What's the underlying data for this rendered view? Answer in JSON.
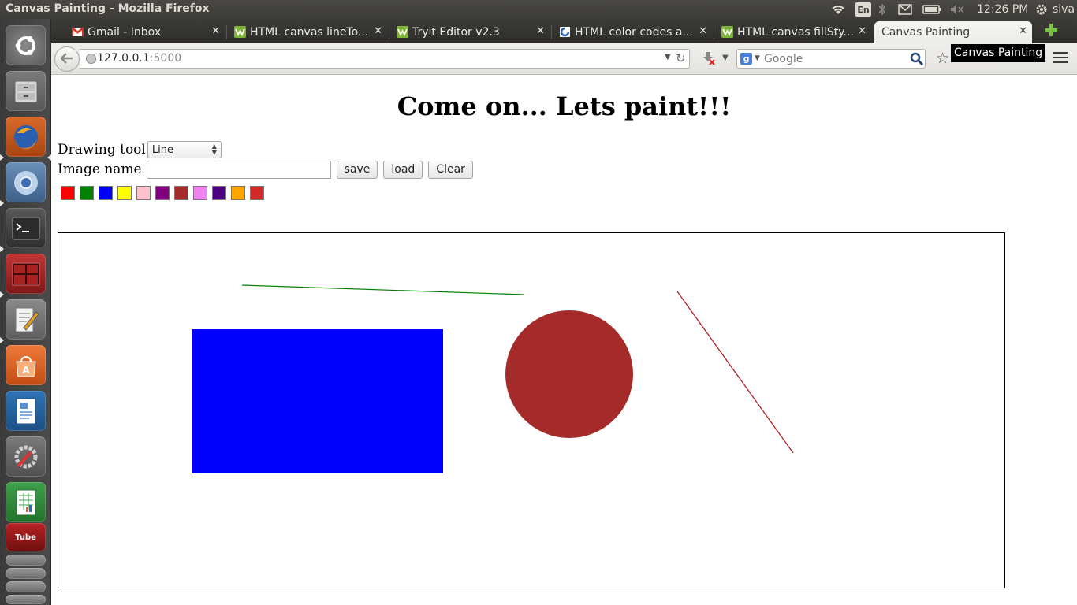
{
  "topbar": {
    "window_title": "Canvas Painting - Mozilla Firefox",
    "lang": "En",
    "clock": "12:26 PM",
    "user": "siva"
  },
  "tabs": [
    {
      "label": "Gmail - Inbox",
      "icon": "gmail-icon",
      "active": false
    },
    {
      "label": "HTML canvas lineTo...",
      "icon": "w3schools-icon",
      "active": false
    },
    {
      "label": "Tryit Editor v2.3",
      "icon": "w3schools-icon",
      "active": false
    },
    {
      "label": "HTML color codes a...",
      "icon": "colorcodes-icon",
      "active": false
    },
    {
      "label": "HTML canvas fillSty...",
      "icon": "w3schools-icon",
      "active": false
    },
    {
      "label": "Canvas Painting",
      "icon": "",
      "active": true
    }
  ],
  "navbar": {
    "url_host": "127.0.0.1",
    "url_port": ":5000",
    "search_placeholder": "Google"
  },
  "tooltip": "Canvas Painting",
  "page": {
    "title": "Come on... Lets paint!!!",
    "drawing_tool_label": "Drawing tool",
    "drawing_tool_value": "Line",
    "image_name_label": "Image name",
    "image_name_value": "",
    "save_label": "save",
    "load_label": "load",
    "clear_label": "Clear",
    "palette": [
      {
        "name": "red",
        "hex": "#ff0000"
      },
      {
        "name": "green",
        "hex": "#008000"
      },
      {
        "name": "blue",
        "hex": "#0000ff"
      },
      {
        "name": "yellow",
        "hex": "#ffff00"
      },
      {
        "name": "pink",
        "hex": "#ffc0cb"
      },
      {
        "name": "purple",
        "hex": "#800080"
      },
      {
        "name": "brown",
        "hex": "#a52a2a"
      },
      {
        "name": "violet",
        "hex": "#ee82ee"
      },
      {
        "name": "indigo",
        "hex": "#4b0082"
      },
      {
        "name": "orange",
        "hex": "#ffa500"
      },
      {
        "name": "crimson",
        "hex": "#d02a2a"
      }
    ]
  },
  "canvas_shapes": [
    {
      "kind": "line",
      "color": "#008000"
    },
    {
      "kind": "rect",
      "color": "#0000ff"
    },
    {
      "kind": "circle",
      "color": "#a52a2a"
    },
    {
      "kind": "line",
      "color": "#b22222"
    }
  ]
}
